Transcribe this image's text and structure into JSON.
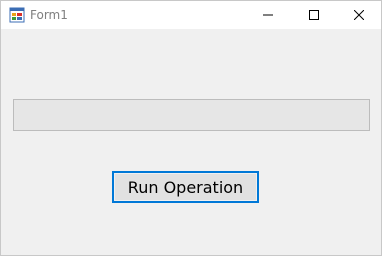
{
  "window": {
    "title": "Form1",
    "icon": "winforms-app-icon"
  },
  "titlebar": {
    "minimize_icon": "minimize-icon",
    "maximize_icon": "maximize-icon",
    "close_icon": "close-icon"
  },
  "progress": {
    "value": 0
  },
  "button": {
    "label": "Run Operation"
  },
  "colors": {
    "focus_border": "#0078d7",
    "progress_track": "#e6e6e6",
    "background": "#f0f0f0"
  }
}
